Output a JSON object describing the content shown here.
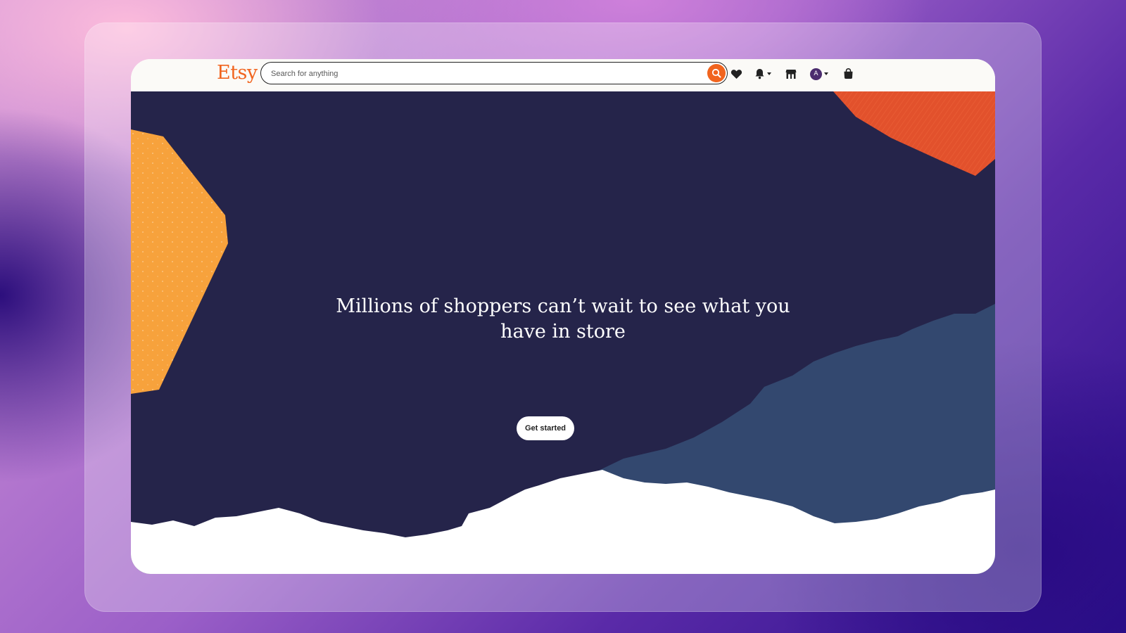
{
  "brand": {
    "logo": "Etsy",
    "accent_color": "#f1641e"
  },
  "search": {
    "placeholder": "Search for anything",
    "value": "",
    "button_icon": "magnifier-icon"
  },
  "header_icons": [
    {
      "name": "favorites",
      "icon": "heart-icon"
    },
    {
      "name": "notifications",
      "icon": "bell-icon",
      "has_dropdown": true
    },
    {
      "name": "shop-manager",
      "icon": "storefront-icon"
    },
    {
      "name": "account",
      "icon": "avatar",
      "avatar_letter": "A",
      "has_dropdown": true
    },
    {
      "name": "cart",
      "icon": "shopping-bag-icon"
    }
  ],
  "hero": {
    "headline": "Millions of shoppers can’t wait to see what you have in store",
    "cta_label": "Get started",
    "background_color": "#25244a",
    "shape_colors": {
      "orange": "#f7a23c",
      "red_orange": "#e2512c",
      "slate_blue": "#33486f",
      "white": "#ffffff"
    }
  }
}
